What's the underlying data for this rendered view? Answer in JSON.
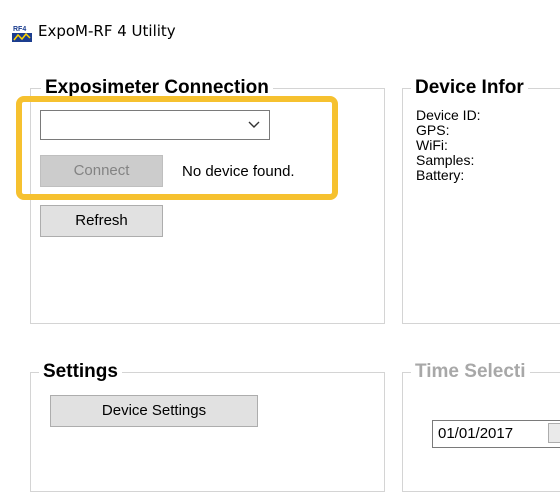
{
  "window": {
    "title": "ExpoM-RF 4 Utility"
  },
  "connection": {
    "legend": "Exposimeter Connection",
    "device_select_value": "",
    "connect_label": "Connect",
    "status": "No device found.",
    "refresh_label": "Refresh"
  },
  "device_info": {
    "legend": "Device Infor",
    "labels": [
      "Device ID:",
      "GPS:",
      "WiFi:",
      "Samples:",
      "Battery:"
    ]
  },
  "settings": {
    "legend": "Settings",
    "device_settings_label": "Device Settings"
  },
  "time_selection": {
    "legend": "Time Selecti",
    "start_date": "01/01/2017"
  },
  "colors": {
    "highlight": "#f6c12f",
    "disabled_text": "#a8a8a8"
  },
  "icons": {
    "app": "rf4-app-icon",
    "dropdown": "chevron-down-icon"
  }
}
